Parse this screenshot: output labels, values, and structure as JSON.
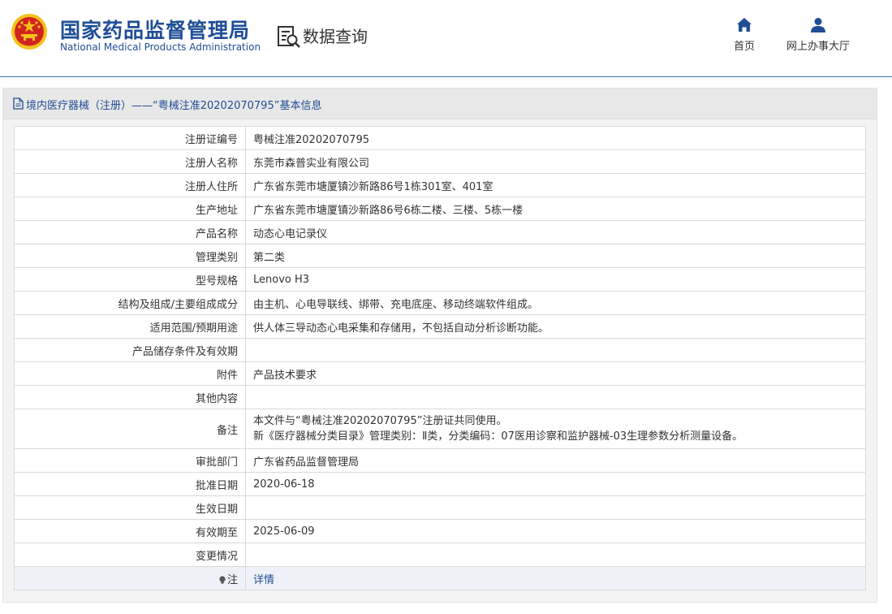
{
  "header": {
    "brand_cn": "国家药品监督管理局",
    "brand_en": "National Medical Products Administration",
    "section_title": "数据查询",
    "nav": {
      "home_label": "首页",
      "hall_label": "网上办事大厅"
    }
  },
  "panel": {
    "title": "境内医疗器械（注册）——“粤械注准20202070795”基本信息"
  },
  "table": {
    "rows": [
      {
        "label": "注册证编号",
        "value": "粤械注准20202070795"
      },
      {
        "label": "注册人名称",
        "value": "东莞市森普实业有限公司"
      },
      {
        "label": "注册人住所",
        "value": "广东省东莞市塘厦镇沙新路86号1栋301室、401室"
      },
      {
        "label": "生产地址",
        "value": "广东省东莞市塘厦镇沙新路86号6栋二楼、三楼、5栋一楼"
      },
      {
        "label": "产品名称",
        "value": "动态心电记录仪"
      },
      {
        "label": "管理类别",
        "value": "第二类"
      },
      {
        "label": "型号规格",
        "value": "Lenovo H3"
      },
      {
        "label": "结构及组成/主要组成成分",
        "value": "由主机、心电导联线、绑带、充电底座、移动终端软件组成。"
      },
      {
        "label": "适用范围/预期用途",
        "value": "供人体三导动态心电采集和存储用，不包括自动分析诊断功能。"
      },
      {
        "label": "产品储存条件及有效期",
        "value": ""
      },
      {
        "label": "附件",
        "value": "产品技术要求"
      },
      {
        "label": "其他内容",
        "value": ""
      },
      {
        "label": "备注",
        "value_line1": "本文件与“粤械注准20202070795”注册证共同使用。",
        "value_line2": "新《医疗器械分类目录》管理类别：Ⅱ类，分类编码：07医用诊察和监护器械-03生理参数分析测量设备。"
      },
      {
        "label": "审批部门",
        "value": "广东省药品监督管理局"
      },
      {
        "label": "批准日期",
        "value": "2020-06-18"
      },
      {
        "label": "生效日期",
        "value": ""
      },
      {
        "label": "有效期至",
        "value": "2025-06-09"
      },
      {
        "label": "变更情况",
        "value": ""
      },
      {
        "label": "注",
        "value": "详情"
      }
    ]
  },
  "colors": {
    "brand_blue": "#1f4e96",
    "emblem_red": "#d2241f",
    "emblem_gold": "#f3c21b"
  },
  "icons": [
    "national-emblem-icon",
    "data-query-icon",
    "home-icon",
    "user-icon",
    "document-icon",
    "lightbulb-icon"
  ]
}
